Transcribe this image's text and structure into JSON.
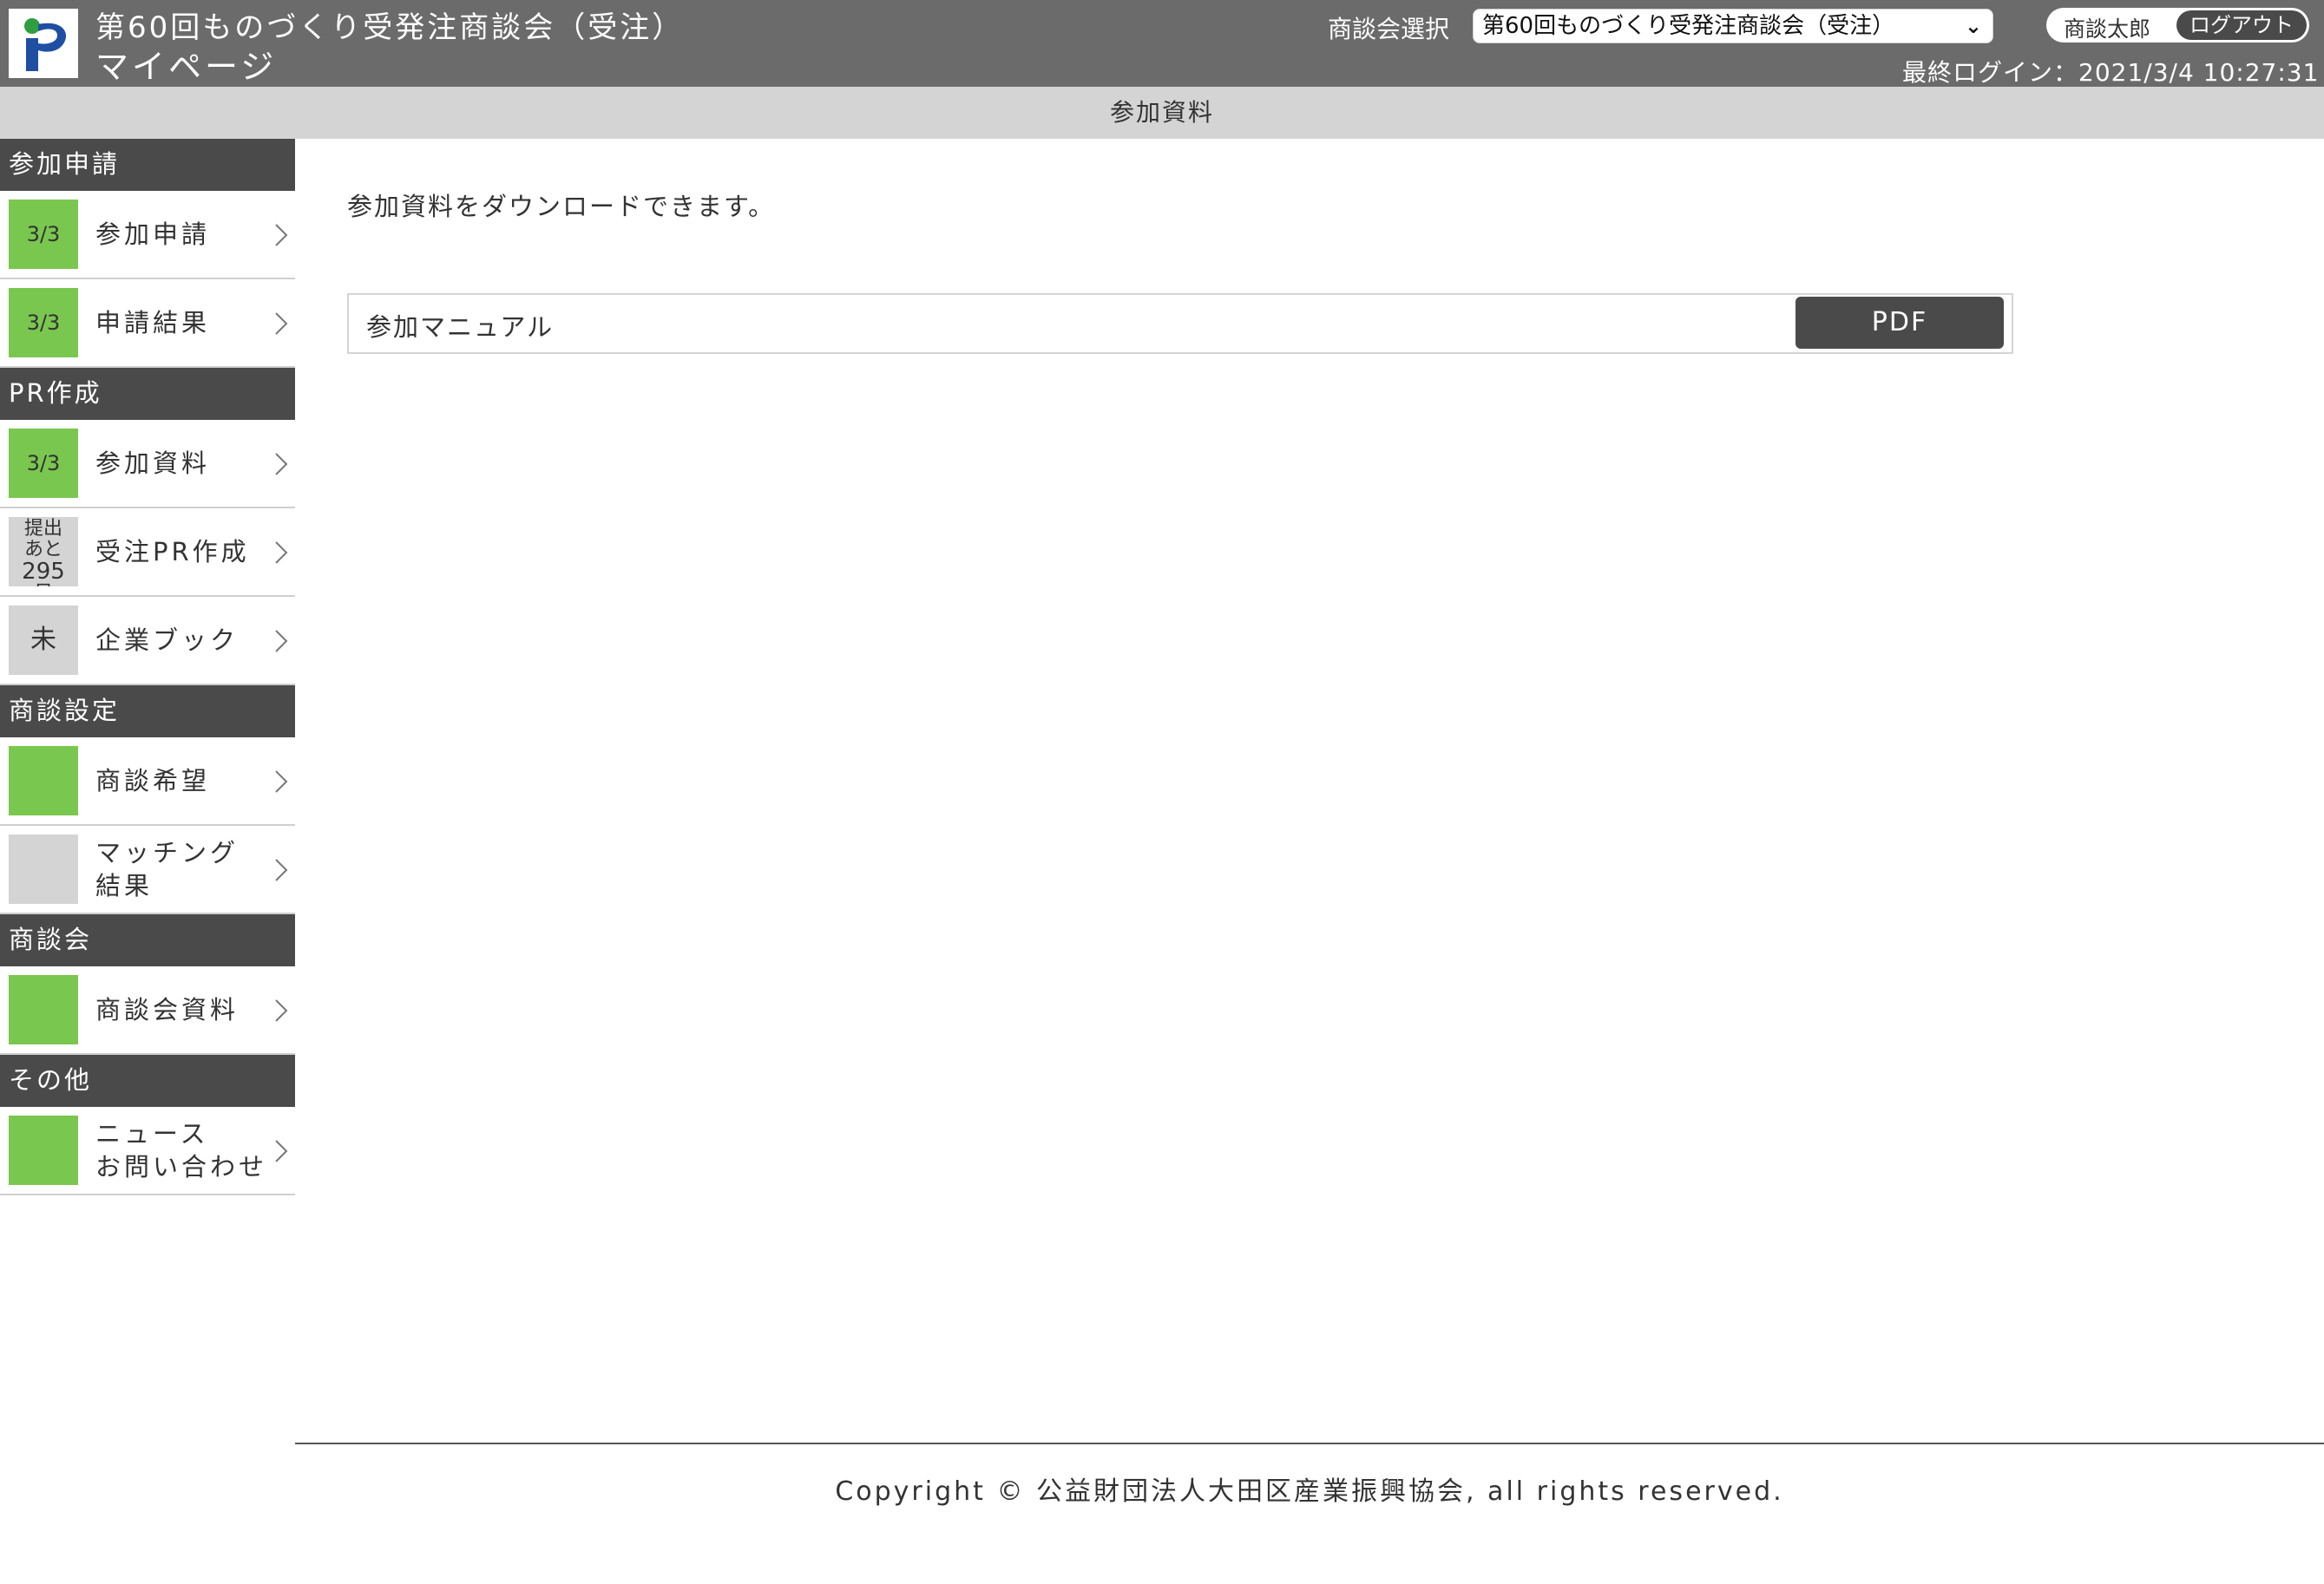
{
  "header": {
    "title_line1": "第60回ものづくり受発注商談会（受注）",
    "title_line2": "マイページ",
    "event_select_label": "商談会選択",
    "event_select_value": "第60回ものづくり受発注商談会（受注）",
    "user_name": "商談太郎",
    "logout_label": "ログアウト",
    "last_login": "最終ログイン：2021/3/4 10:27:31"
  },
  "page_title": "参加資料",
  "sidebar": {
    "sections": [
      {
        "title": "参加申請",
        "items": [
          {
            "badge": "3/3",
            "label": "参加申請",
            "status": "green"
          },
          {
            "badge": "3/3",
            "label": "申請結果",
            "status": "green"
          }
        ]
      },
      {
        "title": "PR作成",
        "items": [
          {
            "badge": "3/3",
            "label": "参加資料",
            "status": "green"
          },
          {
            "badge_line1": "提出",
            "badge_line2": "あと",
            "badge_line3": "295",
            "badge_line4": "日",
            "label": "受注PR作成",
            "status": "gray"
          },
          {
            "badge": "未",
            "label": "企業ブック",
            "status": "gray"
          }
        ]
      },
      {
        "title": "商談設定",
        "items": [
          {
            "badge": "",
            "label": "商談希望",
            "status": "green"
          },
          {
            "badge": "",
            "label_line1": "マッチング",
            "label_line2": "結果",
            "status": "gray"
          }
        ]
      },
      {
        "title": "商談会",
        "items": [
          {
            "badge": "",
            "label": "商談会資料",
            "status": "green"
          }
        ]
      },
      {
        "title": "その他",
        "items": [
          {
            "badge": "",
            "label_line1": "ニュース",
            "label_line2": "お問い合わせ",
            "status": "green"
          }
        ]
      }
    ]
  },
  "main": {
    "intro": "参加資料をダウンロードできます。",
    "documents": [
      {
        "name": "参加マニュアル",
        "button_label": "PDF"
      }
    ]
  },
  "footer": {
    "copyright": "Copyright © 公益財団法人大田区産業振興協会, all rights reserved."
  },
  "colors": {
    "header_bg": "#6b6b6b",
    "section_bg": "#4a4a4a",
    "status_green": "#7ac74f",
    "status_gray": "#d4d4d4",
    "title_bar_bg": "#d4d4d4"
  }
}
